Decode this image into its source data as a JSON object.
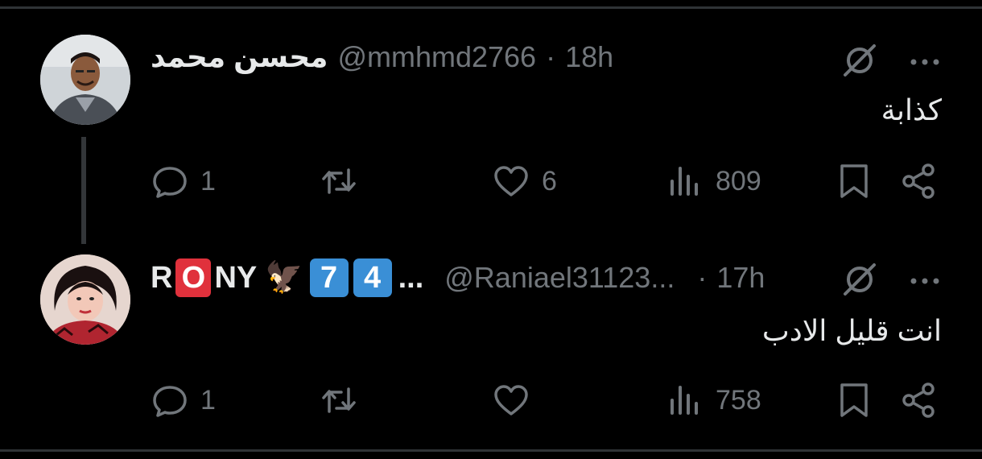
{
  "tweets": [
    {
      "display_name": "محسن محمد",
      "handle": "@mmhmd2766",
      "separator": "·",
      "time": "18h",
      "text": "كذابة",
      "stats": {
        "replies": "1",
        "retweets": "",
        "likes": "6",
        "views": "809"
      }
    },
    {
      "display_name_parts": [
        "R",
        "O",
        "NY",
        "🦅",
        "7",
        "4",
        "..."
      ],
      "handle": "@Raniael31123...",
      "separator": "·",
      "time": "17h",
      "text": "انت قليل الادب",
      "stats": {
        "replies": "1",
        "retweets": "",
        "likes": "",
        "views": "758"
      }
    }
  ],
  "icons": {
    "grok": "grok-icon",
    "more": "more-icon",
    "reply": "reply-icon",
    "retweet": "retweet-icon",
    "like": "heart-icon",
    "views": "views-icon",
    "bookmark": "bookmark-icon",
    "share": "share-icon"
  },
  "colors": {
    "background": "#000000",
    "text": "#e7e9ea",
    "secondary": "#71767b",
    "divider": "#2f3336",
    "name_box_red": "#e0313c",
    "keycap_blue": "#3a8fd6"
  }
}
